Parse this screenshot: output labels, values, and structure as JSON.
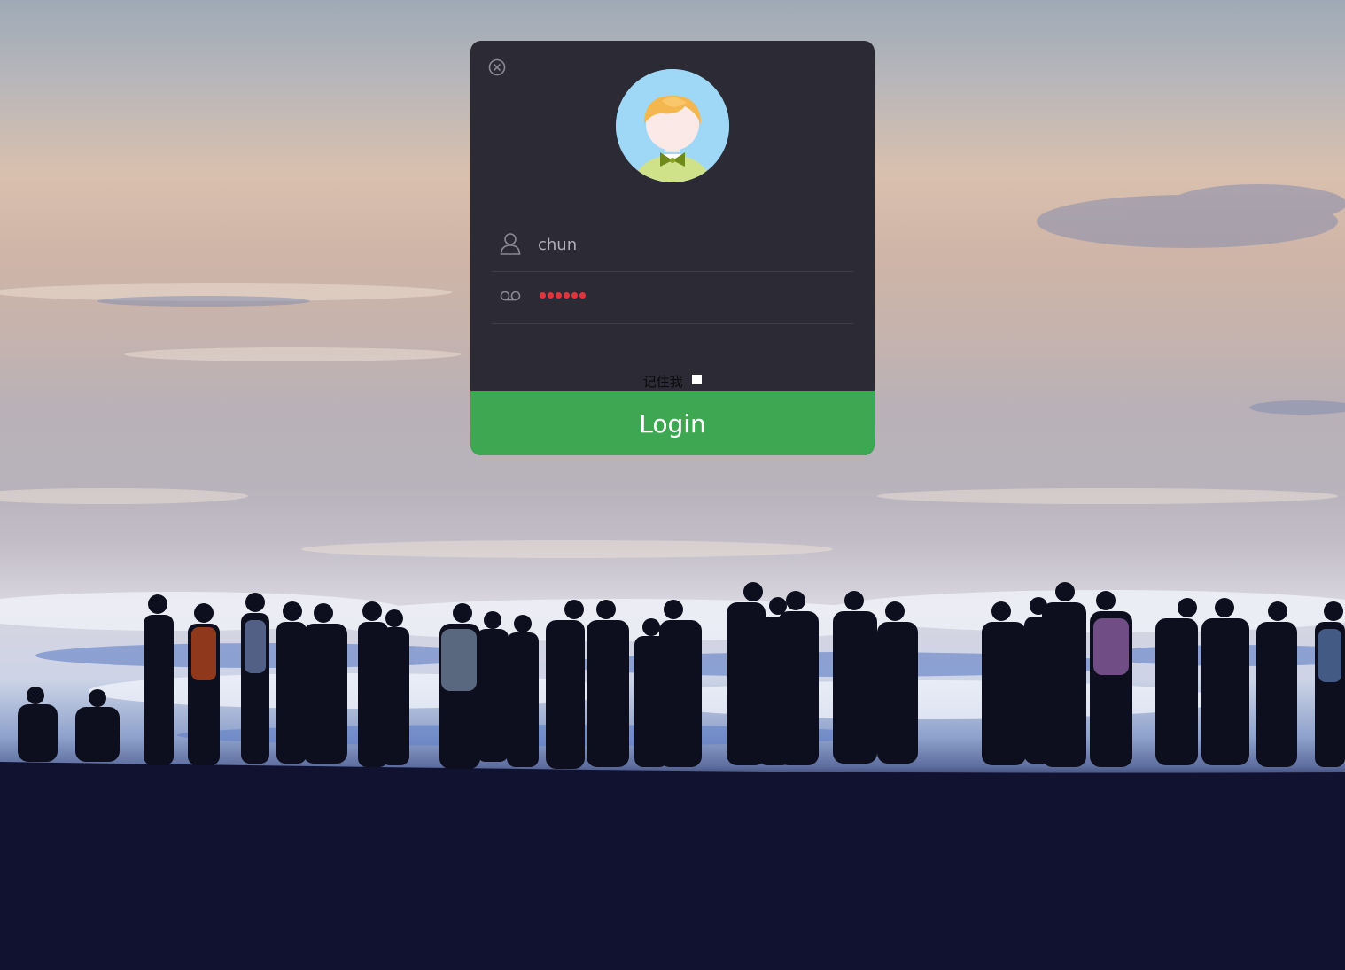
{
  "login": {
    "username_value": "chun",
    "password_mask_length": 6,
    "remember_label": "记住我",
    "remember_checked": false,
    "submit_label": "Login"
  },
  "icons": {
    "close": "close-circle-icon",
    "user": "user-icon",
    "password": "voicemail-key-icon"
  },
  "colors": {
    "card_bg": "#2c2b35",
    "submit_bg": "#3ea752",
    "password_dot": "#e0353b",
    "avatar_bg": "#9ed8f6"
  }
}
